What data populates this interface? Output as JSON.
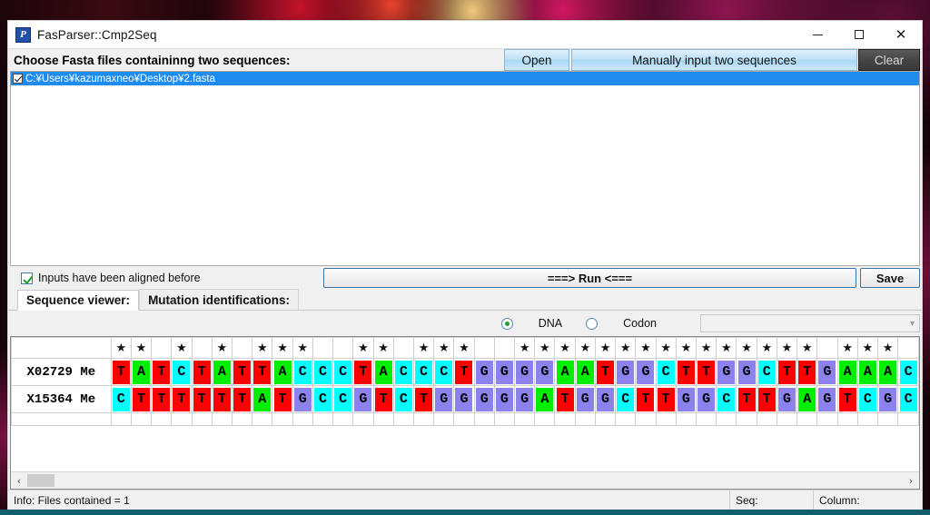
{
  "window": {
    "title": "FasParser::Cmp2Seq",
    "icon": "app-icon-P",
    "minimize": "—",
    "maximize": "☐",
    "close": "✕"
  },
  "toolbar": {
    "choose_label": "Choose Fasta files containinng two sequences:",
    "open_label": "Open",
    "manual_label": "Manually input two sequences",
    "clear_label": "Clear"
  },
  "file_list": {
    "items": [
      {
        "path": "C:¥Users¥kazumaxneo¥Desktop¥2.fasta",
        "checked": true,
        "selected": true
      }
    ]
  },
  "align_row": {
    "aligned_label": "Inputs have been aligned before",
    "aligned_checked": true,
    "run_label": "===> Run <===",
    "save_label": "Save"
  },
  "tabs": [
    {
      "label": "Sequence viewer:",
      "active": true
    },
    {
      "label": "Mutation identifications:",
      "active": false
    }
  ],
  "mode_row": {
    "dna_label": "DNA",
    "codon_label": "Codon",
    "selected": "DNA",
    "combo_value": "",
    "combo_caret": "▾"
  },
  "sequence_viewer": {
    "star_glyph": "★",
    "rows": [
      {
        "label": "X02729 Me",
        "bases": [
          "T",
          "A",
          "T",
          "C",
          "T",
          "A",
          "T",
          "T",
          "A",
          "C",
          "C",
          "C",
          "T",
          "A",
          "C",
          "C",
          "C",
          "T",
          "G",
          "G",
          "G",
          "G",
          "A",
          "A",
          "T",
          "G",
          "G",
          "C",
          "T",
          "T",
          "G",
          "G",
          "C",
          "T",
          "T",
          "G",
          "A",
          "A",
          "A",
          "C"
        ]
      },
      {
        "label": "X15364 Me",
        "bases": [
          "C",
          "T",
          "T",
          "T",
          "T",
          "T",
          "T",
          "A",
          "T",
          "G",
          "C",
          "C",
          "G",
          "T",
          "C",
          "T",
          "G",
          "G",
          "G",
          "G",
          "G",
          "A",
          "T",
          "G",
          "G",
          "C",
          "T",
          "T",
          "G",
          "G",
          "C",
          "T",
          "T",
          "G",
          "A",
          "G",
          "T",
          "C",
          "G",
          "C"
        ]
      }
    ],
    "stars": [
      true,
      true,
      false,
      true,
      false,
      true,
      false,
      true,
      true,
      true,
      false,
      false,
      true,
      true,
      false,
      true,
      true,
      true,
      false,
      false,
      true,
      true,
      true,
      true,
      true,
      true,
      true,
      true,
      true,
      true,
      true,
      true,
      true,
      true,
      true,
      false,
      true,
      true,
      true,
      false
    ]
  },
  "scrollbar": {
    "left_arrow": "‹",
    "right_arrow": "›"
  },
  "statusbar": {
    "info": "Info: Files contained = 1",
    "seq": "Seq:",
    "column": "Column:"
  },
  "colors": {
    "base_A": "#00ee00",
    "base_T": "#ff0000",
    "base_C": "#00ffff",
    "base_G": "#8b82ee",
    "selection": "#1f8ced",
    "accent": "#a8d7f2",
    "clear_button": "#454545"
  }
}
